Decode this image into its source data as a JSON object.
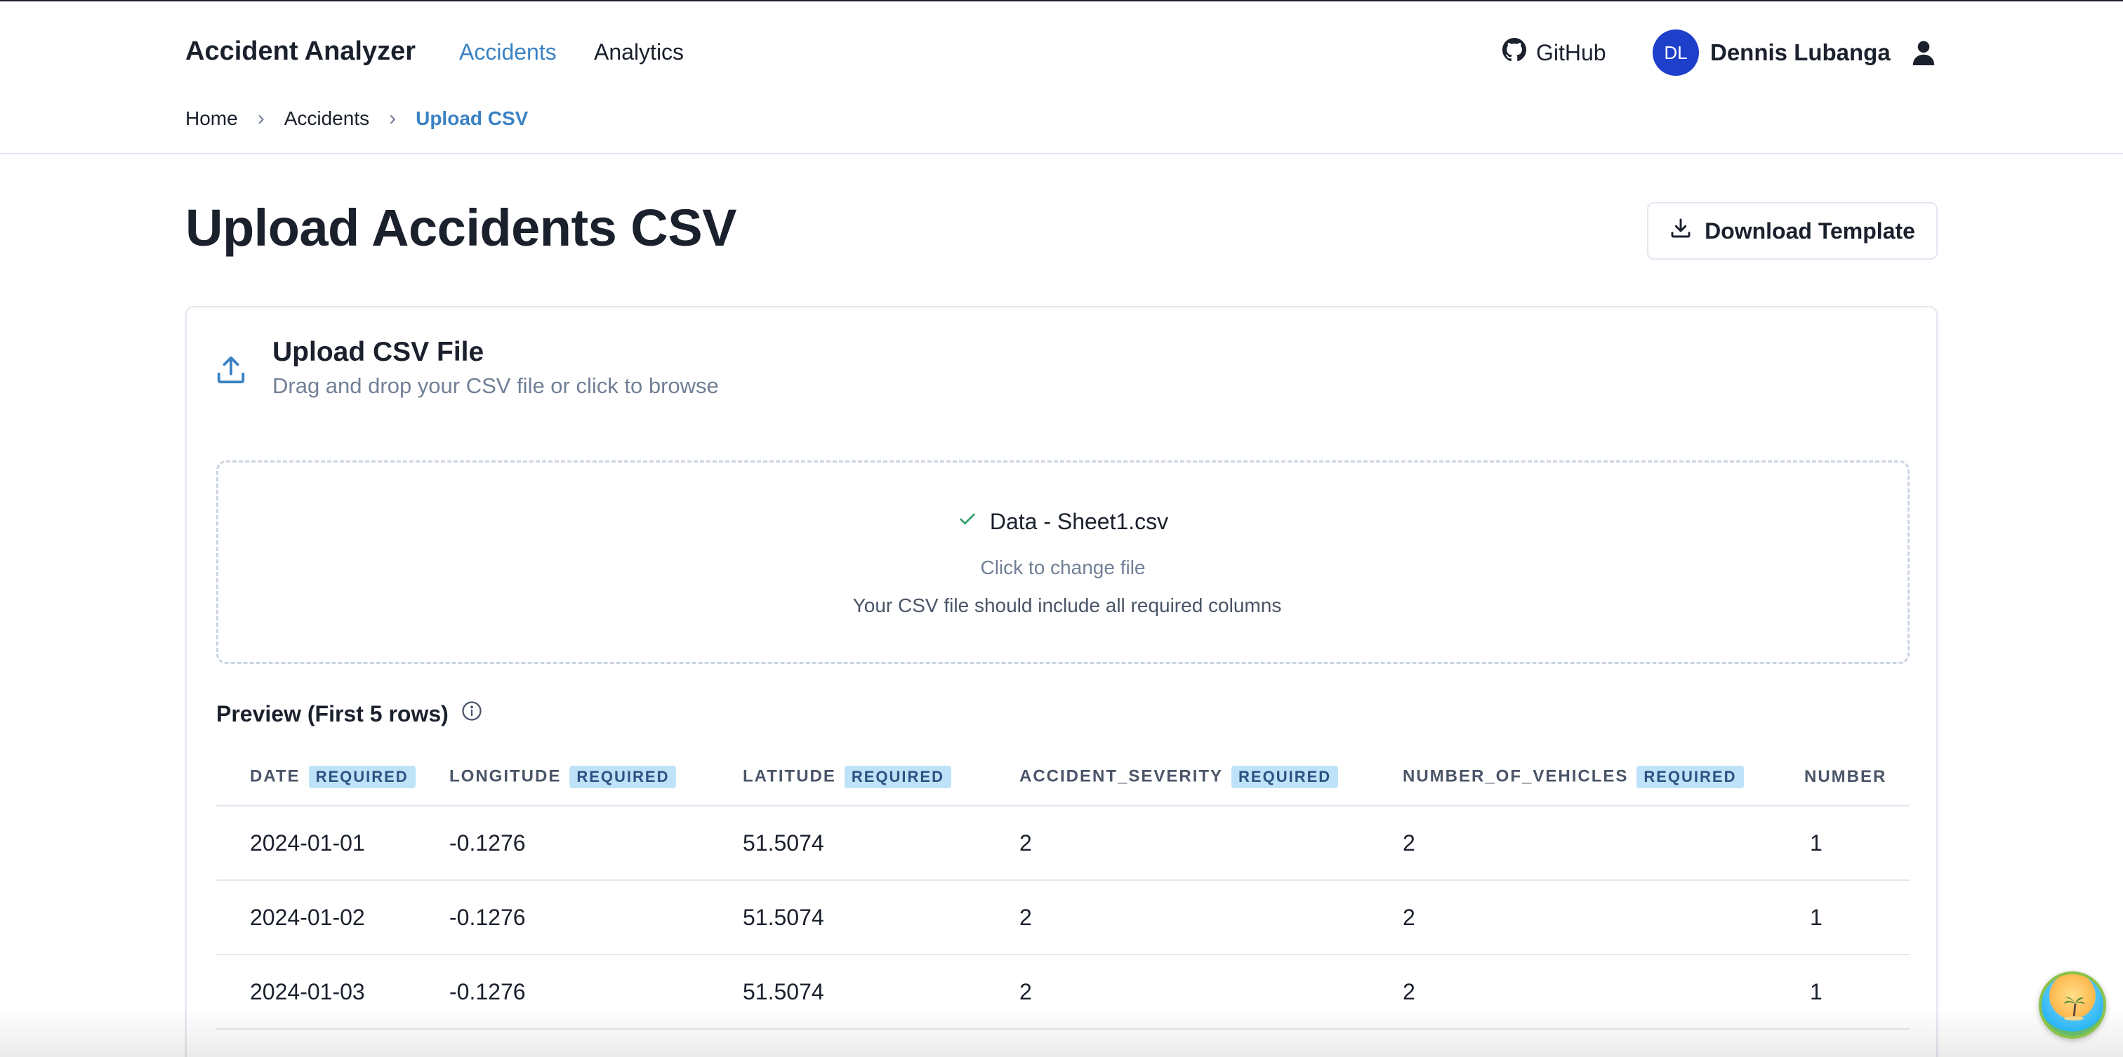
{
  "header": {
    "brand": "Accident Analyzer",
    "nav": [
      {
        "label": "Accidents",
        "active": true
      },
      {
        "label": "Analytics",
        "active": false
      }
    ],
    "github_label": "GitHub",
    "user": {
      "initials": "DL",
      "name": "Dennis Lubanga"
    }
  },
  "breadcrumb": {
    "items": [
      "Home",
      "Accidents"
    ],
    "current": "Upload CSV",
    "separator": "›"
  },
  "page": {
    "title": "Upload Accidents CSV",
    "download_label": "Download Template"
  },
  "upload_card": {
    "title": "Upload CSV File",
    "subtitle": "Drag and drop your CSV file or click to browse",
    "file_name": "Data - Sheet1.csv",
    "change_label": "Click to change file",
    "hint": "Your CSV file should include all required columns"
  },
  "preview": {
    "title": "Preview (First 5 rows)",
    "required_label": "REQUIRED",
    "columns": [
      {
        "name": "DATE",
        "required": true
      },
      {
        "name": "LONGITUDE",
        "required": true
      },
      {
        "name": "LATITUDE",
        "required": true
      },
      {
        "name": "ACCIDENT_SEVERITY",
        "required": true
      },
      {
        "name": "NUMBER_OF_VEHICLES",
        "required": true
      },
      {
        "name": "NUMBER",
        "required": false
      }
    ],
    "rows": [
      [
        "2024-01-01",
        "-0.1276",
        "51.5074",
        "2",
        "2",
        "1"
      ],
      [
        "2024-01-02",
        "-0.1276",
        "51.5074",
        "2",
        "2",
        "1"
      ],
      [
        "2024-01-03",
        "-0.1276",
        "51.5074",
        "2",
        "2",
        "1"
      ]
    ]
  },
  "colors": {
    "accent": "#3b82c4",
    "avatar_bg": "#1e3fc9",
    "badge_bg": "#bee3f8",
    "success": "#38a169"
  },
  "icons": {
    "github": "github-icon",
    "user": "user-icon",
    "download": "download-icon",
    "upload": "upload-icon",
    "check": "check-icon",
    "info": "info-icon"
  }
}
